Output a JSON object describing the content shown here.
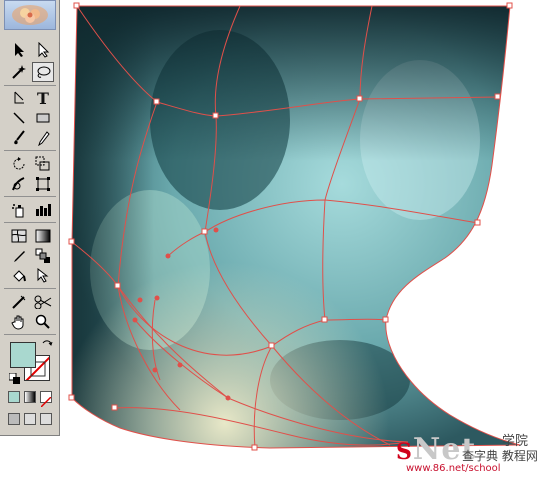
{
  "app": {
    "tools": [
      {
        "name": "selection-tool",
        "icon": "arrow-black"
      },
      {
        "name": "direct-selection-tool",
        "icon": "arrow-white"
      },
      {
        "name": "magic-wand-tool",
        "icon": "wand"
      },
      {
        "name": "lasso-tool",
        "icon": "lasso",
        "selected": true
      },
      {
        "name": "pen-tool",
        "icon": "pen"
      },
      {
        "name": "type-tool",
        "icon": "type",
        "glyph": "T"
      },
      {
        "name": "line-segment-tool",
        "icon": "line"
      },
      {
        "name": "rectangle-tool",
        "icon": "rectangle"
      },
      {
        "name": "paintbrush-tool",
        "icon": "brush"
      },
      {
        "name": "pencil-tool",
        "icon": "pencil"
      },
      {
        "name": "rotate-tool",
        "icon": "rotate"
      },
      {
        "name": "scale-tool",
        "icon": "scale"
      },
      {
        "name": "warp-tool",
        "icon": "warp"
      },
      {
        "name": "free-transform-tool",
        "icon": "free-transform"
      },
      {
        "name": "symbol-sprayer-tool",
        "icon": "sprayer"
      },
      {
        "name": "column-graph-tool",
        "icon": "graph"
      },
      {
        "name": "mesh-tool",
        "icon": "mesh"
      },
      {
        "name": "gradient-tool",
        "icon": "gradient"
      },
      {
        "name": "eyedropper-tool",
        "icon": "eyedropper"
      },
      {
        "name": "blend-tool",
        "icon": "blend"
      },
      {
        "name": "live-paint-bucket-tool",
        "icon": "paint-bucket"
      },
      {
        "name": "live-paint-selection-tool",
        "icon": "paint-selection"
      },
      {
        "name": "slice-tool",
        "icon": "slice"
      },
      {
        "name": "scissors-tool",
        "icon": "scissors"
      },
      {
        "name": "hand-tool",
        "icon": "hand"
      },
      {
        "name": "zoom-tool",
        "icon": "zoom"
      }
    ],
    "fill_color": "#a9d8cf",
    "stroke_color": "none",
    "mesh_color": "#e0504a",
    "watermark": {
      "brand": "Net",
      "brand_prefix": "S",
      "cn_line1": "学院",
      "cn_line2": "查字典 教程网",
      "url": "www.86.net/school"
    }
  }
}
